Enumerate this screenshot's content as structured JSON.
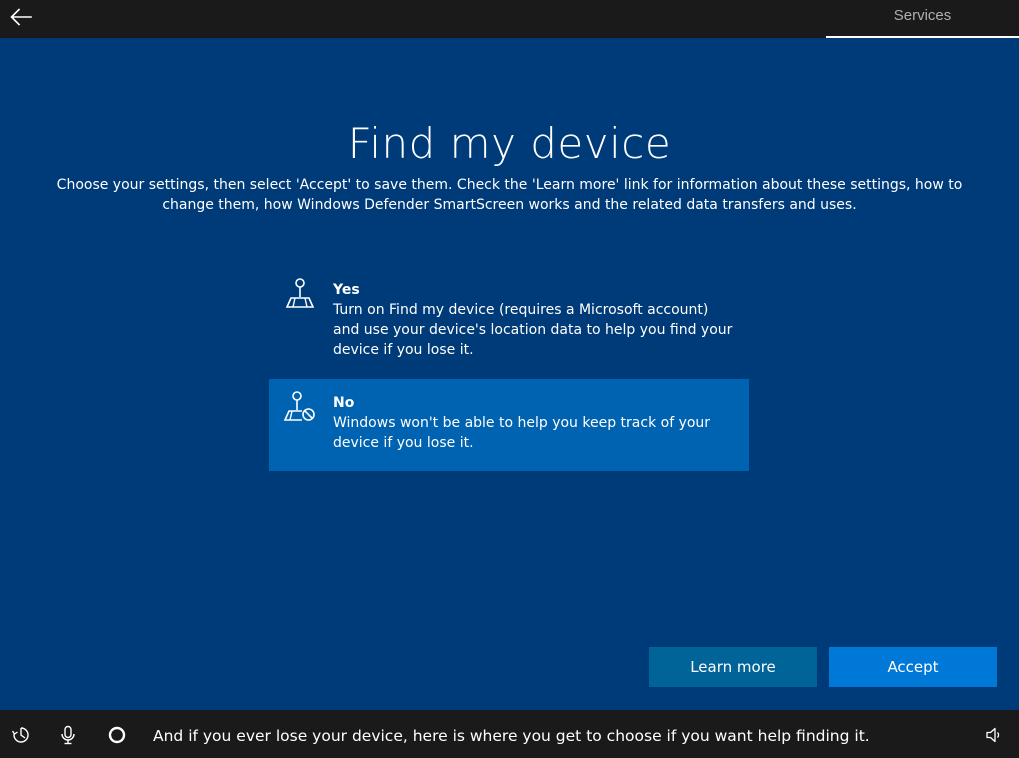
{
  "topbar": {
    "back_icon": "back-arrow-icon",
    "tab_label": "Services"
  },
  "page": {
    "title": "Find my device",
    "subtitle": "Choose your settings, then select 'Accept' to save them. Check the 'Learn more' link for information about these settings, how to change them, how Windows Defender SmartScreen works and the related data transfers and uses."
  },
  "options": [
    {
      "id": "yes",
      "title": "Yes",
      "description": "Turn on Find my device (requires a Microsoft account) and use your device's location data to help you find your device if you lose it.",
      "icon": "location-map-icon",
      "selected": false
    },
    {
      "id": "no",
      "title": "No",
      "description": "Windows won't be able to help you keep track of your device if you lose it.",
      "icon": "location-map-off-icon",
      "selected": true
    }
  ],
  "buttons": {
    "learn_more": "Learn more",
    "accept": "Accept"
  },
  "bottombar": {
    "caption": "And if you ever lose your device, here is where you get to choose if you want help finding it.",
    "icons": [
      "ease-of-access-icon",
      "microphone-icon",
      "cortana-icon",
      "volume-icon"
    ]
  },
  "colors": {
    "background": "#003b79",
    "selected_option": "#0063b1",
    "learn_more_button": "#006499",
    "accept_button": "#0078d7",
    "bars": "#1a1a1a"
  }
}
